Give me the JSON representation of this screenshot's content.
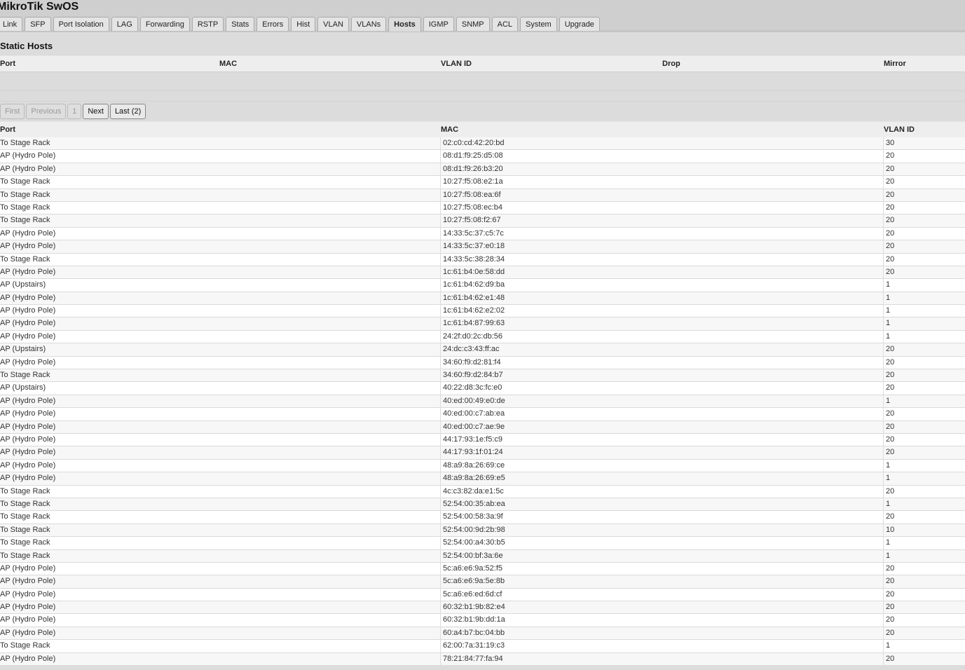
{
  "app_title": "MikroTik SwOS",
  "tabs": [
    "Link",
    "SFP",
    "Port Isolation",
    "LAG",
    "Forwarding",
    "RSTP",
    "Stats",
    "Errors",
    "Hist",
    "VLAN",
    "VLANs",
    "Hosts",
    "IGMP",
    "SNMP",
    "ACL",
    "System",
    "Upgrade"
  ],
  "active_tab": "Hosts",
  "static_hosts": {
    "title": "Static Hosts",
    "columns": [
      "Port",
      "MAC",
      "VLAN ID",
      "Drop",
      "Mirror"
    ]
  },
  "pagination": {
    "first": "First",
    "previous": "Previous",
    "page": "1",
    "next": "Next",
    "last": "Last (2)"
  },
  "hosts": {
    "columns": [
      "Port",
      "MAC",
      "VLAN ID"
    ],
    "rows": [
      [
        "To Stage Rack",
        "02:c0:cd:42:20:bd",
        "30"
      ],
      [
        "AP (Hydro Pole)",
        "08:d1:f9:25:d5:08",
        "20"
      ],
      [
        "AP (Hydro Pole)",
        "08:d1:f9:26:b3:20",
        "20"
      ],
      [
        "To Stage Rack",
        "10:27:f5:08:e2:1a",
        "20"
      ],
      [
        "To Stage Rack",
        "10:27:f5:08:ea:6f",
        "20"
      ],
      [
        "To Stage Rack",
        "10:27:f5:08:ec:b4",
        "20"
      ],
      [
        "To Stage Rack",
        "10:27:f5:08:f2:67",
        "20"
      ],
      [
        "AP (Hydro Pole)",
        "14:33:5c:37:c5:7c",
        "20"
      ],
      [
        "AP (Hydro Pole)",
        "14:33:5c:37:e0:18",
        "20"
      ],
      [
        "To Stage Rack",
        "14:33:5c:38:28:34",
        "20"
      ],
      [
        "AP (Hydro Pole)",
        "1c:61:b4:0e:58:dd",
        "20"
      ],
      [
        "AP (Upstairs)",
        "1c:61:b4:62:d9:ba",
        "1"
      ],
      [
        "AP (Hydro Pole)",
        "1c:61:b4:62:e1:48",
        "1"
      ],
      [
        "AP (Hydro Pole)",
        "1c:61:b4:62:e2:02",
        "1"
      ],
      [
        "AP (Hydro Pole)",
        "1c:61:b4:87:99:63",
        "1"
      ],
      [
        "AP (Hydro Pole)",
        "24:2f:d0:2c:db:56",
        "1"
      ],
      [
        "AP (Upstairs)",
        "24:dc:c3:43:ff:ac",
        "20"
      ],
      [
        "AP (Hydro Pole)",
        "34:60:f9:d2:81:f4",
        "20"
      ],
      [
        "To Stage Rack",
        "34:60:f9:d2:84:b7",
        "20"
      ],
      [
        "AP (Upstairs)",
        "40:22:d8:3c:fc:e0",
        "20"
      ],
      [
        "AP (Hydro Pole)",
        "40:ed:00:49:e0:de",
        "1"
      ],
      [
        "AP (Hydro Pole)",
        "40:ed:00:c7:ab:ea",
        "20"
      ],
      [
        "AP (Hydro Pole)",
        "40:ed:00:c7:ae:9e",
        "20"
      ],
      [
        "AP (Hydro Pole)",
        "44:17:93:1e:f5:c9",
        "20"
      ],
      [
        "AP (Hydro Pole)",
        "44:17:93:1f:01:24",
        "20"
      ],
      [
        "AP (Hydro Pole)",
        "48:a9:8a:26:69:ce",
        "1"
      ],
      [
        "AP (Hydro Pole)",
        "48:a9:8a:26:69:e5",
        "1"
      ],
      [
        "To Stage Rack",
        "4c:c3:82:da:e1:5c",
        "20"
      ],
      [
        "To Stage Rack",
        "52:54:00:35:ab:ea",
        "1"
      ],
      [
        "To Stage Rack",
        "52:54:00:58:3a:9f",
        "20"
      ],
      [
        "To Stage Rack",
        "52:54:00:9d:2b:98",
        "10"
      ],
      [
        "To Stage Rack",
        "52:54:00:a4:30:b5",
        "1"
      ],
      [
        "To Stage Rack",
        "52:54:00:bf:3a:6e",
        "1"
      ],
      [
        "AP (Hydro Pole)",
        "5c:a6:e6:9a:52:f5",
        "20"
      ],
      [
        "AP (Hydro Pole)",
        "5c:a6:e6:9a:5e:8b",
        "20"
      ],
      [
        "AP (Hydro Pole)",
        "5c:a6:e6:ed:6d:cf",
        "20"
      ],
      [
        "AP (Hydro Pole)",
        "60:32:b1:9b:82:e4",
        "20"
      ],
      [
        "AP (Hydro Pole)",
        "60:32:b1:9b:dd:1a",
        "20"
      ],
      [
        "AP (Hydro Pole)",
        "60:a4:b7:bc:04:bb",
        "20"
      ],
      [
        "To Stage Rack",
        "62:00:7a:31:19:c3",
        "1"
      ],
      [
        "AP (Hydro Pole)",
        "78:21:84:77:fa:94",
        "20"
      ]
    ]
  }
}
